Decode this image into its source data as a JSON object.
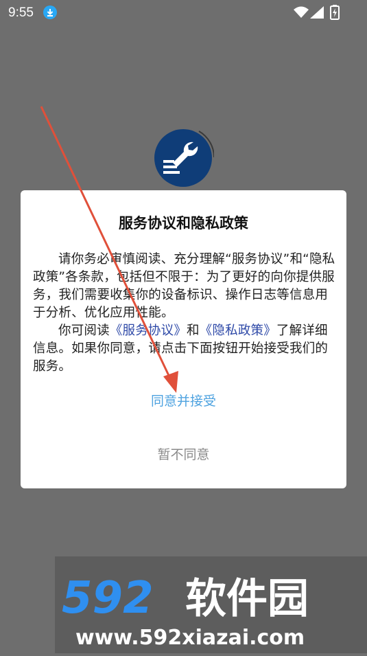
{
  "status_bar": {
    "time": "9:55",
    "icons": [
      "download-icon",
      "wifi-icon",
      "signal-icon",
      "battery-icon"
    ]
  },
  "colors": {
    "overlay": "#6e6e6e",
    "link": "#2f4aa8",
    "agree": "#4fa3e0",
    "decline": "#8a8a8a",
    "arrow": "#e0503a",
    "logo_bg": "#0f3d78"
  },
  "dialog": {
    "title": "服务协议和隐私政策",
    "para1": "请你务必审慎阅读、充分理解“服务协议”和“隐私政策”各条款，包括但不限于：为了更好的向你提供服务，我们需要收集你的设备标识、操作日志等信息用于分析、优化应用性能。",
    "para2_prefix": "你可阅读",
    "link_service": "《服务协议》",
    "para2_and": "和",
    "link_privacy": "《隐私政策》",
    "para2_suffix": "了解详细信息。如果你同意，请点击下面按钮开始接受我们的服务。",
    "agree_label": "同意并接受",
    "decline_label": "暂不同意"
  },
  "watermark": {
    "brand": "592软件园",
    "url": "www.592xiazai.com"
  }
}
